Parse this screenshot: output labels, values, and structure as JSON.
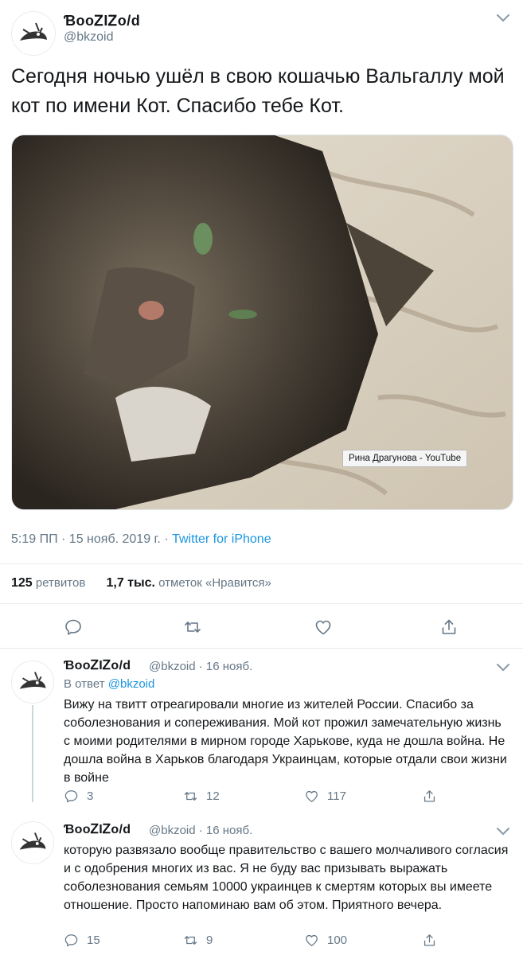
{
  "main_tweet": {
    "name": "ƁooᏃƖᏃo/d",
    "handle": "@bkzoid",
    "text": "Сегодня ночью ушёл в свою кошачью  Вальгаллу мой кот по имени Кот. Спасибо тебе Кот.",
    "photo_credit": "Рина Драгунова - YouTube",
    "time": "5:19 ПП · 15 нояб. 2019 г. · ",
    "client": "Twitter for iPhone",
    "retweets_count": "125",
    "retweets_label": "ретвитов",
    "likes_count": "1,7 тыс.",
    "likes_label": "отметок «Нравится»"
  },
  "replies": [
    {
      "name": "ƁooᏃƖᏃo/d",
      "handle_date": "@bkzoid · 16 нояб.",
      "reply_to_label": "В ответ",
      "reply_to_handle": "@bkzoid",
      "text": "Вижу на твитт отреагировали многие из жителей России. Спасибо за соболезнования и сопереживания. Мой кот прожил замечательную жизнь с моими родителями в мирном городе Харькове, куда не дошла война. Не дошла война в Харьков благодаря Украинцам, которые отдали свои жизни в войне",
      "replies": "3",
      "retweets": "12",
      "likes": "117"
    },
    {
      "name": "ƁooᏃƖᏃo/d",
      "handle_date": "@bkzoid · 16 нояб.",
      "text": "которую развязало вообще правительство с вашего молчаливого согласия и с одобрения многих из вас. Я не буду вас призывать выражать соболезнования семьям 10000 украинцев к смертям которых вы имеете отношение. Просто напоминаю вам об этом. Приятного вечера.",
      "replies": "15",
      "retweets": "9",
      "likes": "100"
    }
  ],
  "colors": {
    "text": "#14171a",
    "muted": "#657786",
    "link": "#1b95e0",
    "divider": "#e6ecf0"
  }
}
